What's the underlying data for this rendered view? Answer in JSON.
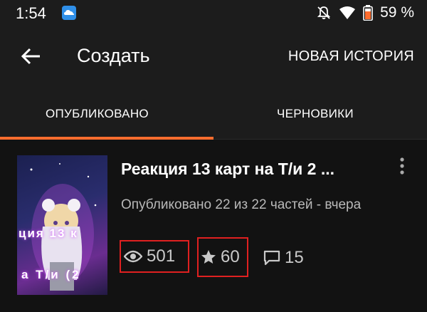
{
  "status_bar": {
    "time": "1:54",
    "battery_percent": "59 %",
    "icons": [
      "cloud-app-icon",
      "notifications-off-icon",
      "wifi-icon",
      "battery-icon"
    ]
  },
  "app_bar": {
    "title": "Создать",
    "new_story_label": "НОВАЯ ИСТОРИЯ",
    "back_icon": "back-arrow-icon"
  },
  "tabs": [
    {
      "label": "ОПУБЛИКОВАНО",
      "active": true
    },
    {
      "label": "ЧЕРНОВИКИ",
      "active": false
    }
  ],
  "colors": {
    "accent": "#ff6d2e",
    "highlight_box": "#e02020",
    "background": "#121212",
    "bar": "#1c1c1c"
  },
  "story": {
    "title": "Реакция 13 карт на Т/и 2 ...",
    "meta": "Опубликовано 22 из 22 частей - вчера",
    "cover_text": [
      "ция 13 к",
      "а Т/и (2"
    ],
    "reads": "501",
    "votes": "60",
    "comments": "15"
  }
}
